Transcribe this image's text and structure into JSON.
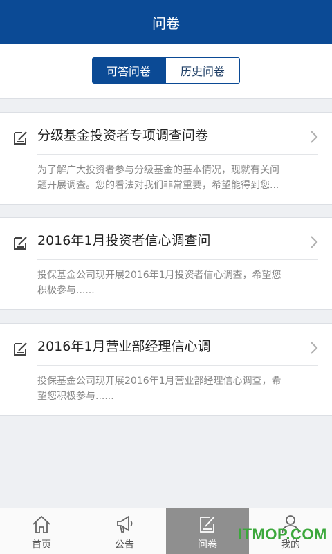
{
  "header": {
    "title": "问卷"
  },
  "segments": [
    {
      "label": "可答问卷",
      "active": true
    },
    {
      "label": "历史问卷",
      "active": false
    }
  ],
  "surveys": [
    {
      "title": "分级基金投资者专项调查问卷",
      "desc_line1": "为了解广大投资者参与分级基金的基本情况，现就有关问",
      "desc_line2": "题开展调查。您的看法对我们非常重要，希望能得到您..."
    },
    {
      "title": "2016年1月投资者信心调查问",
      "desc_line1": "投保基金公司现开展2016年1月投资者信心调查，希望您",
      "desc_line2": "积极参与......"
    },
    {
      "title": "2016年1月营业部经理信心调",
      "desc_line1": "投保基金公司现开展2016年1月营业部经理信心调查，希",
      "desc_line2": "望您积极参与......"
    }
  ],
  "tabs": [
    {
      "label": "首页",
      "icon": "home-icon"
    },
    {
      "label": "公告",
      "icon": "megaphone-icon"
    },
    {
      "label": "问卷",
      "icon": "survey-edit-icon",
      "active": true
    },
    {
      "label": "我的",
      "icon": "user-icon"
    }
  ],
  "watermark": "ITMOP.COM",
  "colors": {
    "primary": "#0b4a95",
    "active_tab": "#8f8f8f",
    "watermark": "#3ca83c"
  }
}
